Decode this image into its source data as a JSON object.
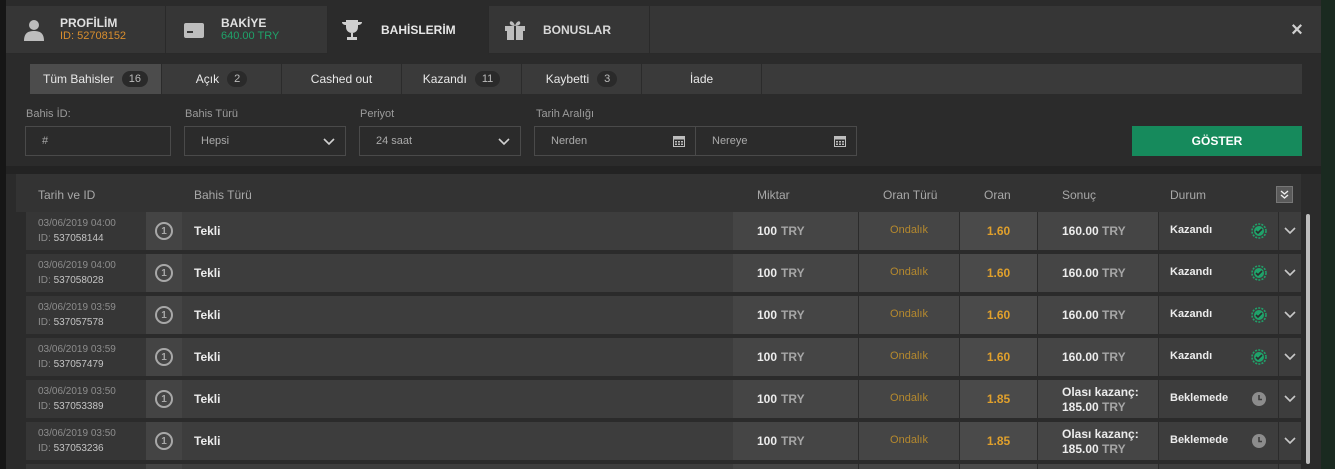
{
  "header": {
    "profile": {
      "title": "PROFİLİM",
      "sub": "ID: 52708152",
      "sub_color": "#d98e2e"
    },
    "balance": {
      "title": "BAKİYE",
      "sub": "640.00 TRY",
      "sub_color": "#1fa36a"
    },
    "bets": {
      "title": "BAHİSLERİM"
    },
    "bonuses": {
      "title": "BONUSLAR"
    },
    "close": "×"
  },
  "subtabs": [
    {
      "label": "Tüm Bahisler",
      "count": "16",
      "active": true
    },
    {
      "label": "Açık",
      "count": "2"
    },
    {
      "label": "Cashed out",
      "count": ""
    },
    {
      "label": "Kazandı",
      "count": "11"
    },
    {
      "label": "Kaybetti",
      "count": "3"
    },
    {
      "label": "İade",
      "count": ""
    }
  ],
  "filters": {
    "bet_id": {
      "label": "Bahis İD:",
      "placeholder": "#"
    },
    "bet_type": {
      "label": "Bahis Türü",
      "value": "Hepsi"
    },
    "period": {
      "label": "Periyot",
      "value": "24 saat"
    },
    "date_range": {
      "label": "Tarih Aralığı",
      "from": "Nerden",
      "to": "Nereye"
    },
    "show_button": "GÖSTER"
  },
  "table": {
    "columns": {
      "date_id": "Tarih ve ID",
      "bet_type": "Bahis Türü",
      "amount": "Miktar",
      "odds_type": "Oran Türü",
      "odds": "Oran",
      "result": "Sonuç",
      "status": "Durum"
    },
    "rows": [
      {
        "date": "03/06/2019 04:00",
        "id": "537058144",
        "count": "1",
        "type": "Tekli",
        "amount": "100",
        "currency": "TRY",
        "odds_type": "Ondalık",
        "odds": "1.60",
        "result_label": "",
        "result": "160.00",
        "status": "Kazandı",
        "status_kind": "won"
      },
      {
        "date": "03/06/2019 04:00",
        "id": "537058028",
        "count": "1",
        "type": "Tekli",
        "amount": "100",
        "currency": "TRY",
        "odds_type": "Ondalık",
        "odds": "1.60",
        "result_label": "",
        "result": "160.00",
        "status": "Kazandı",
        "status_kind": "won"
      },
      {
        "date": "03/06/2019 03:59",
        "id": "537057578",
        "count": "1",
        "type": "Tekli",
        "amount": "100",
        "currency": "TRY",
        "odds_type": "Ondalık",
        "odds": "1.60",
        "result_label": "",
        "result": "160.00",
        "status": "Kazandı",
        "status_kind": "won"
      },
      {
        "date": "03/06/2019 03:59",
        "id": "537057479",
        "count": "1",
        "type": "Tekli",
        "amount": "100",
        "currency": "TRY",
        "odds_type": "Ondalık",
        "odds": "1.60",
        "result_label": "",
        "result": "160.00",
        "status": "Kazandı",
        "status_kind": "won"
      },
      {
        "date": "03/06/2019 03:50",
        "id": "537053389",
        "count": "1",
        "type": "Tekli",
        "amount": "100",
        "currency": "TRY",
        "odds_type": "Ondalık",
        "odds": "1.85",
        "result_label": "Olası kazanç:",
        "result": "185.00",
        "status": "Beklemede",
        "status_kind": "pending"
      },
      {
        "date": "03/06/2019 03:50",
        "id": "537053236",
        "count": "1",
        "type": "Tekli",
        "amount": "100",
        "currency": "TRY",
        "odds_type": "Ondalık",
        "odds": "1.85",
        "result_label": "Olası kazanç:",
        "result": "185.00",
        "status": "Beklemede",
        "status_kind": "pending"
      }
    ]
  },
  "colors": {
    "accent_green": "#168a5c",
    "odds_orange": "#e0a02c",
    "won_green": "#1fa36a"
  }
}
